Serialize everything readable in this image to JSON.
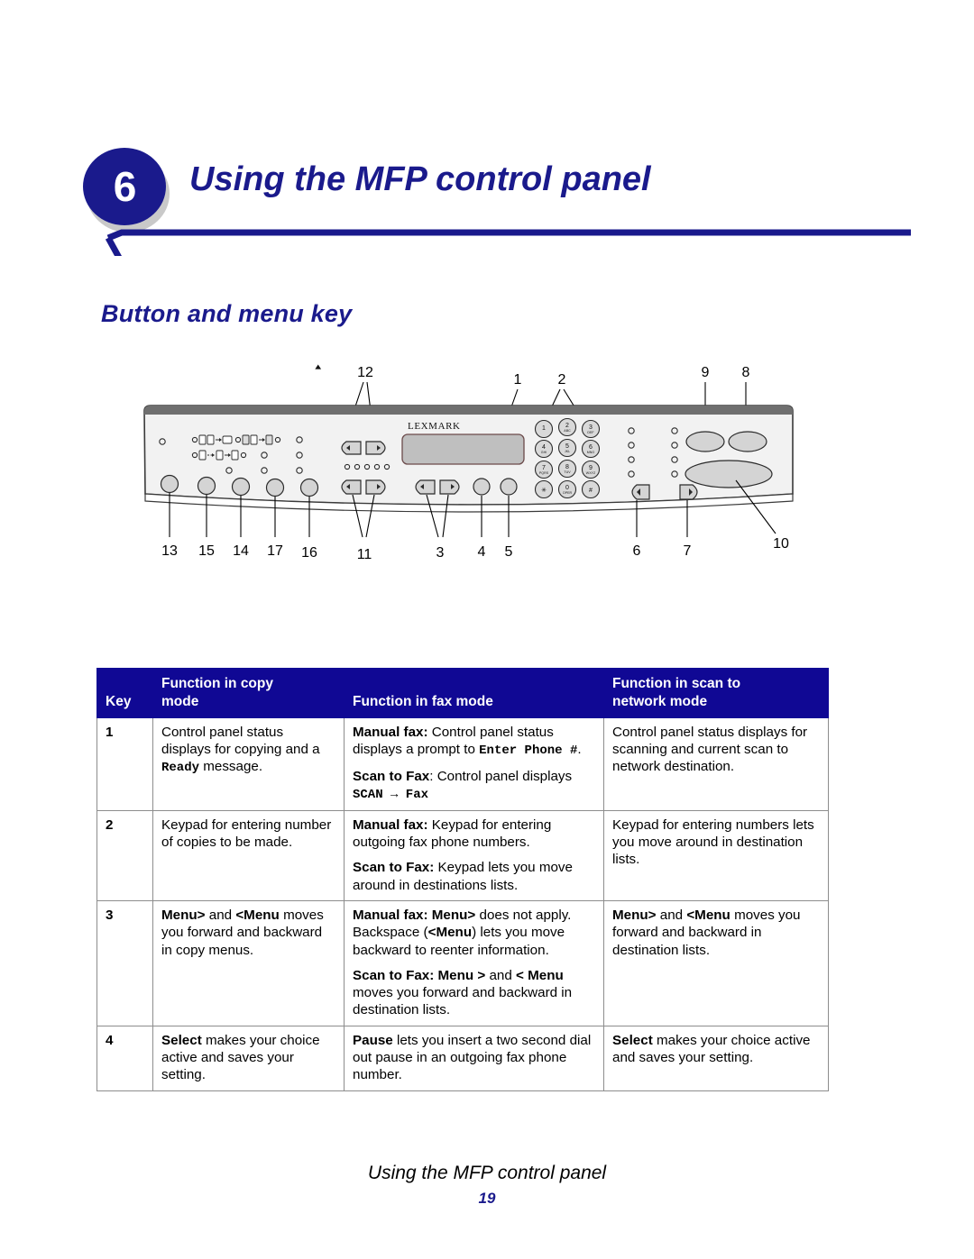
{
  "chapter": {
    "number": "6",
    "title": "Using the MFP control panel"
  },
  "section": {
    "title": "Button and menu key"
  },
  "figure": {
    "name": "mfp-control-panel-diagram",
    "brand_logo": "LEXMARK",
    "callouts_top": [
      "12",
      "1",
      "2",
      "9",
      "8"
    ],
    "callouts_bottom": [
      "13",
      "15",
      "14",
      "17",
      "16",
      "11",
      "3",
      "4",
      "5",
      "6",
      "7",
      "10"
    ],
    "keypad_keys": [
      {
        "digit": "1",
        "letters": ""
      },
      {
        "digit": "2",
        "letters": "ABC"
      },
      {
        "digit": "3",
        "letters": "DEF"
      },
      {
        "digit": "4",
        "letters": "GHI"
      },
      {
        "digit": "5",
        "letters": "JKL"
      },
      {
        "digit": "6",
        "letters": "MNO"
      },
      {
        "digit": "7",
        "letters": "PQRS"
      },
      {
        "digit": "8",
        "letters": "TUV"
      },
      {
        "digit": "9",
        "letters": "WXYZ"
      },
      {
        "digit": "*",
        "letters": ""
      },
      {
        "digit": "0",
        "letters": "OPER"
      },
      {
        "digit": "#",
        "letters": ""
      }
    ]
  },
  "table": {
    "headers": {
      "key": "Key",
      "copy": "Function in copy mode",
      "copy_line1": "Function in copy",
      "copy_line2": "mode",
      "fax": "Function in fax mode",
      "scan_line1": "Function in scan to",
      "scan_line2": "network mode"
    },
    "rows": [
      {
        "key": "1",
        "copy": {
          "p1_a": "Control panel status displays for copying and a ",
          "p1_mono": "Ready",
          "p1_b": " message."
        },
        "fax": {
          "p1_bold": "Manual fax:",
          "p1_a": " Control panel status displays a prompt to ",
          "p1_mono": "Enter Phone #",
          "p1_b": ".",
          "p2_bold": "Scan to Fax",
          "p2_a": ": Control panel displays ",
          "p2_mono": "SCAN → Fax"
        },
        "scan": "Control panel status displays for scanning and current scan to network destination."
      },
      {
        "key": "2",
        "copy": {
          "p1": "Keypad for entering number of copies to be made."
        },
        "fax": {
          "p1_bold": "Manual fax:",
          "p1_a": " Keypad for entering outgoing fax phone numbers.",
          "p2_bold": "Scan to Fax:",
          "p2_a": " Keypad lets you move around in destinations lists."
        },
        "scan": "Keypad for entering numbers lets you move around in destination lists."
      },
      {
        "key": "3",
        "copy": {
          "p1_bold1": "Menu>",
          "p1_mid": " and ",
          "p1_bold2": "<Menu",
          "p1_tail": " moves you forward and backward in copy menus."
        },
        "fax": {
          "p1_bold1": "Manual fax: Menu>",
          "p1_a": " does not apply. Backspace (",
          "p1_bold2": "<Menu",
          "p1_b": ") lets you move backward to reenter information.",
          "p2_bold": "Scan to Fax: Menu >",
          "p2_mid": " and ",
          "p2_bold2": "< Menu",
          "p2_tail": " moves you forward and backward in destination lists."
        },
        "scan": {
          "p1_bold1": "Menu>",
          "p1_mid": " and ",
          "p1_bold2": "<Menu",
          "p1_tail": " moves you forward and backward in destination lists."
        }
      },
      {
        "key": "4",
        "copy": {
          "p1_bold": "Select",
          "p1_tail": " makes your choice active and saves your setting."
        },
        "fax": {
          "p1_bold": "Pause",
          "p1_tail": " lets you insert a two second dial out pause in an outgoing fax phone number."
        },
        "scan": {
          "p1_bold": "Select",
          "p1_tail": " makes your choice active and saves your setting."
        }
      }
    ]
  },
  "footer": {
    "title": "Using the MFP control panel",
    "page": "19"
  },
  "colors": {
    "brand_navy": "#1a1a8c",
    "header_blue": "#100894",
    "panel_face": "#f2f2f2",
    "button_grey": "#d4d4d4"
  }
}
